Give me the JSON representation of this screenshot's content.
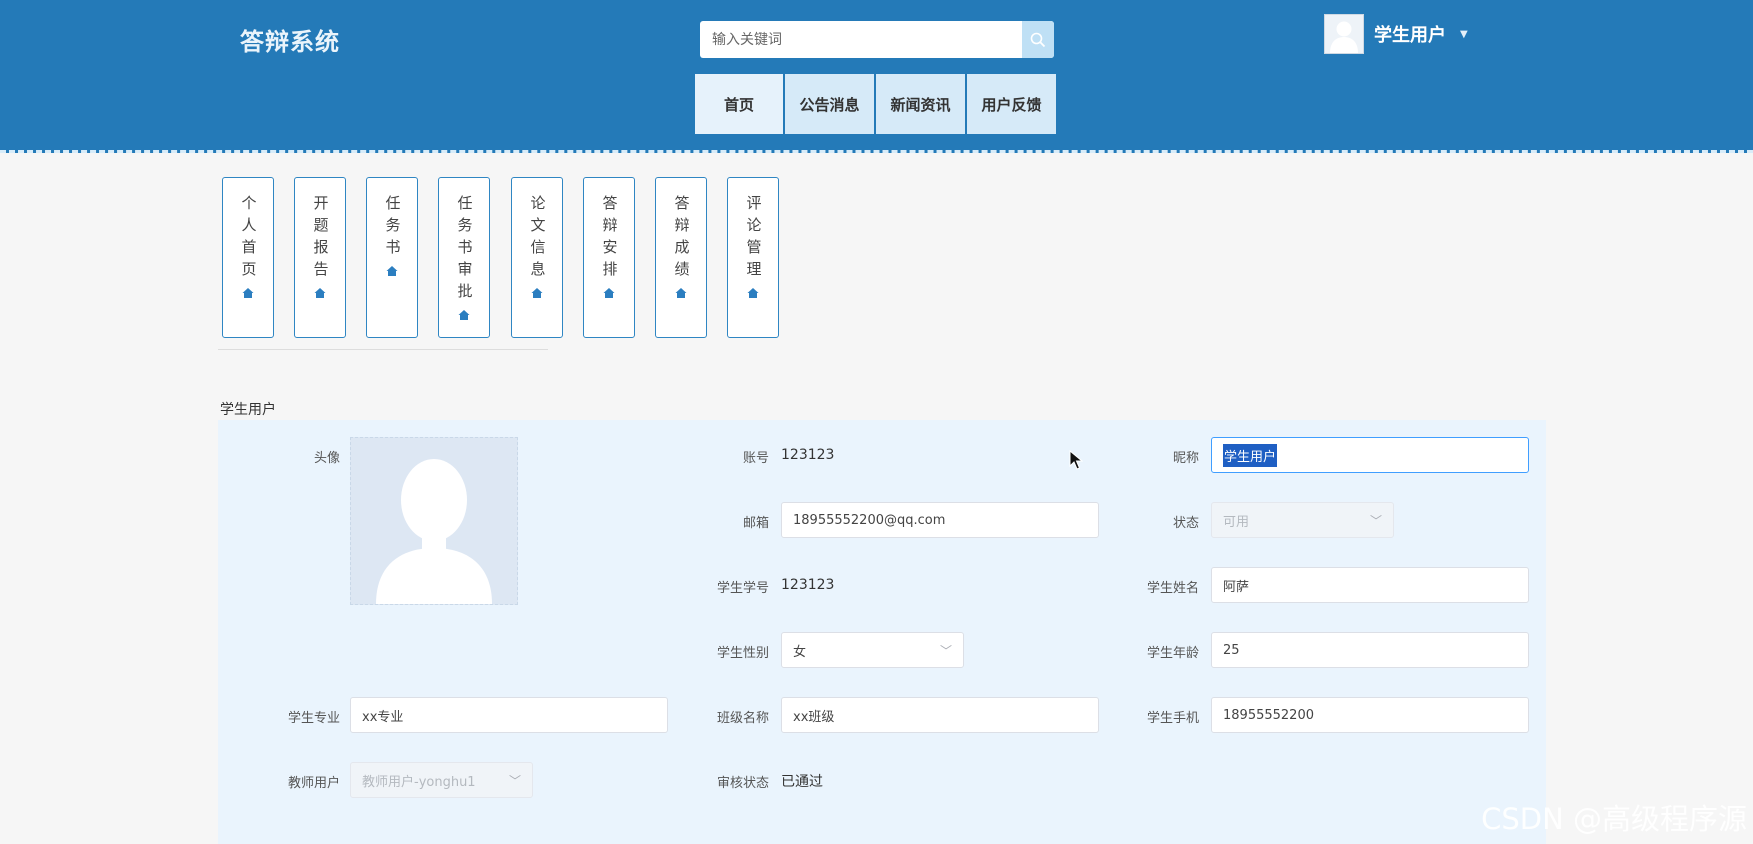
{
  "app": {
    "title": "答辩系统"
  },
  "search": {
    "placeholder": "输入关键词",
    "icon": "search-icon"
  },
  "nav": [
    "首页",
    "公告消息",
    "新闻资讯",
    "用户反馈"
  ],
  "user": {
    "name": "学生用户",
    "avatar_icon": "user-avatar-icon",
    "caret_icon": "caret-down-icon"
  },
  "menu": [
    {
      "label": "个人首页",
      "icon": "home-icon"
    },
    {
      "label": "开题报告",
      "icon": "home-icon"
    },
    {
      "label": "任务书",
      "icon": "home-icon"
    },
    {
      "label": "任务书审批",
      "icon": "home-icon"
    },
    {
      "label": "论文信息",
      "icon": "home-icon"
    },
    {
      "label": "答辩安排",
      "icon": "home-icon"
    },
    {
      "label": "答辩成绩",
      "icon": "home-icon"
    },
    {
      "label": "评论管理",
      "icon": "home-icon"
    }
  ],
  "profile": {
    "section_title": "学生用户",
    "avatar_label": "头像",
    "account_label": "账号",
    "account_value": "123123",
    "nickname_label": "昵称",
    "nickname_value": "学生用户",
    "email_label": "邮箱",
    "email_value": "18955552200@qq.com",
    "status_label": "状态",
    "status_value": "可用",
    "student_no_label": "学生学号",
    "student_no_value": "123123",
    "student_name_label": "学生姓名",
    "student_name_value": "阿萨",
    "gender_label": "学生性别",
    "gender_value": "女",
    "age_label": "学生年龄",
    "age_value": "25",
    "major_label": "学生专业",
    "major_value": "xx专业",
    "class_label": "班级名称",
    "class_value": "xx班级",
    "phone_label": "学生手机",
    "phone_value": "18955552200",
    "teacher_label": "教师用户",
    "teacher_value": "教师用户-yonghu1",
    "review_label": "审核状态",
    "review_value": "已通过"
  },
  "watermark": "CSDN @高级程序源",
  "colors": {
    "header": "#247ab8",
    "nav_bg": "#d6eaf8",
    "panel": "#eaf4fd",
    "tile_border": "#2f86c3"
  }
}
